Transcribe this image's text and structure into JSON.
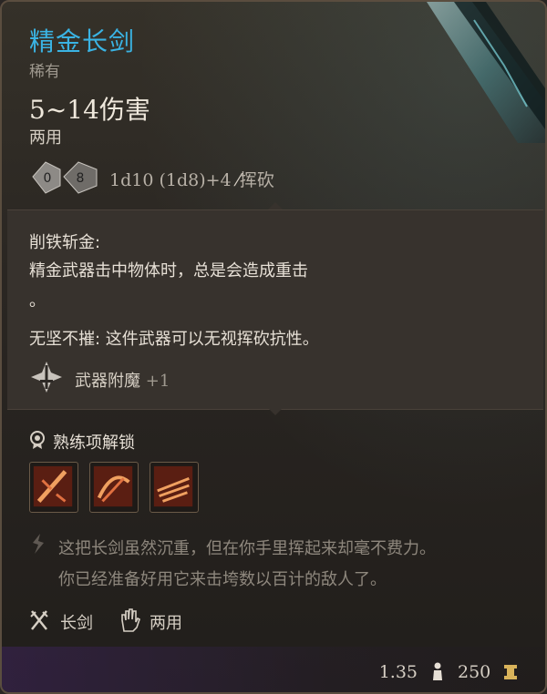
{
  "item": {
    "name": "精金长剑",
    "rarity": "稀有",
    "damage": "5~14伤害",
    "handedness": "两用",
    "dice_left": "0",
    "dice_right": "8",
    "dice_roll": "1d10 (1d8)+4",
    "damage_type": "挥砍"
  },
  "properties": {
    "p1_title": "削铁斩金:",
    "p1_line1": "精金武器击中物体时，总是会造成重击",
    "p1_line2": "。",
    "p2": "无坚不摧: 这件武器可以无视挥砍抗性。",
    "enchant_label": "武器附魔",
    "enchant_value": "+1"
  },
  "proficiency": {
    "title": "熟练项解锁",
    "icons": [
      "slash-skill-icon",
      "flourish-skill-icon",
      "lacerate-skill-icon"
    ]
  },
  "flavor": {
    "line1": "这把长剑虽然沉重，但在你手里挥起来却毫不费力。",
    "line2": "你已经准备好用它来击垮数以百计的敌人了。"
  },
  "tags": {
    "weapon_type": "长剑",
    "hand_type": "两用"
  },
  "footer": {
    "weight": "1.35",
    "value": "250"
  },
  "colors": {
    "title": "#3ab3e3",
    "text": "#e7e0d6",
    "muted": "#8e877d",
    "border": "#5a4d3f",
    "footer_purple": "#3c235a"
  }
}
